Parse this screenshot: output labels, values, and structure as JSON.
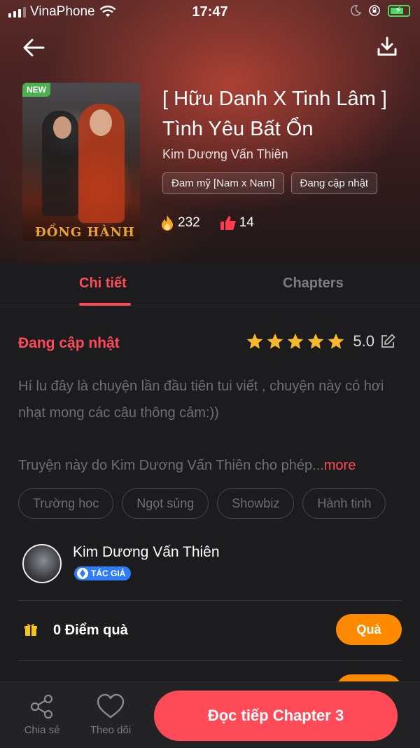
{
  "status_bar": {
    "carrier": "VinaPhone",
    "time": "17:47"
  },
  "book": {
    "badge": "NEW",
    "cover_text": "ĐỒNG HÀNH",
    "title": "[ Hữu Danh X Tinh Lâm ] Tình Yêu Bất Ổn",
    "author": "Kim Dương Vấn Thiên",
    "tags": [
      "Đam mỹ [Nam x Nam]",
      "Đang cập nhật"
    ],
    "views": "232",
    "likes": "14"
  },
  "tabs": [
    {
      "label": "Chi tiết",
      "active": true
    },
    {
      "label": "Chapters",
      "active": false
    }
  ],
  "detail": {
    "status": "Đang cập nhật",
    "rating": "5.0",
    "rating_stars": 5,
    "description": "Hí lu đây là chuyện lần đầu tiên tui viết , chuyện này có hơi nhạt mong các cậu thông cảm:))",
    "description_2": "Truyện này do Kim Dương Vấn Thiên cho phép...",
    "more_label": "more",
    "genres": [
      "Trường hoc",
      "Ngọt sủng",
      "Showbiz",
      "Hành tinh"
    ]
  },
  "author_card": {
    "name": "Kim Dương Vấn Thiên",
    "badge": "TÁC GIẢ"
  },
  "gift": {
    "text": "0 Điểm quà",
    "button": "Quà"
  },
  "bottom_bar": {
    "share_label": "Chia sẻ",
    "follow_label": "Theo dõi",
    "read_button": "Đọc tiếp Chapter 3"
  },
  "colors": {
    "accent": "#ff4b57",
    "orange": "#ff8a00",
    "star": "#f5b82e",
    "badge_blue": "#2f7cf6",
    "new_green": "#4caf50"
  }
}
